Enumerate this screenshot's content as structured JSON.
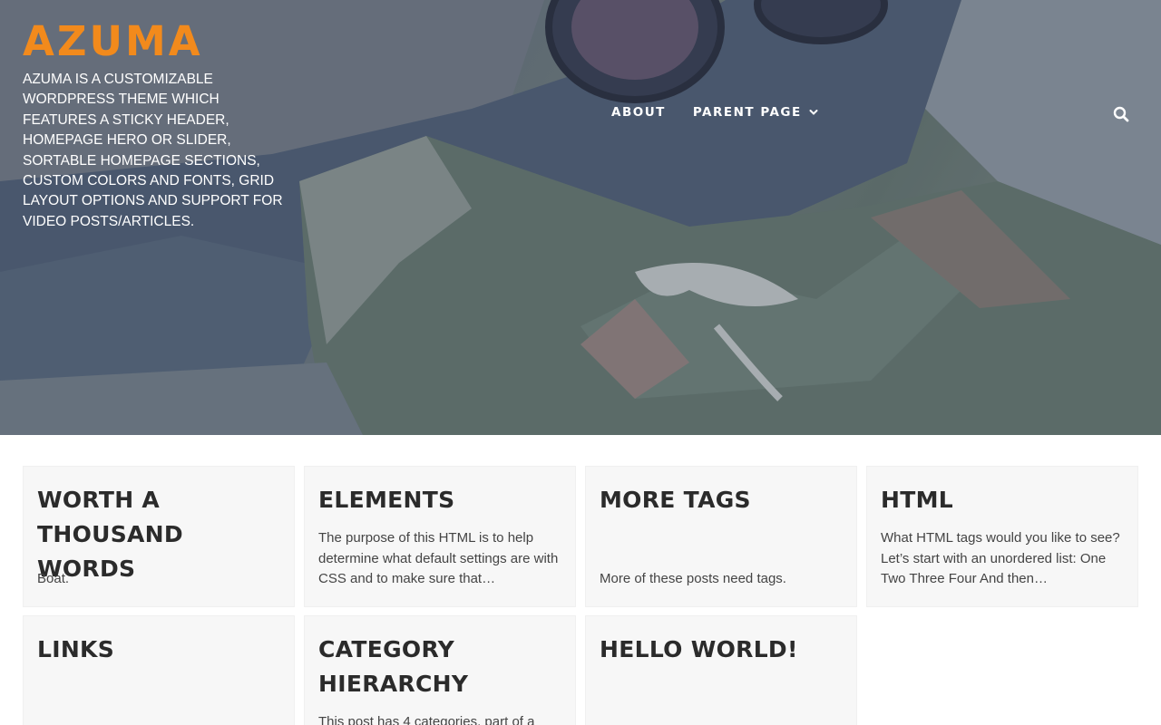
{
  "site": {
    "title": "AZUMA",
    "description": "AZUMA IS A CUSTOMIZABLE WORDPRESS THEME WHICH FEATURES A STICKY HEADER, HOMEPAGE HERO OR SLIDER, SORTABLE HOMEPAGE SECTIONS, CUSTOM COLORS AND FONTS, GRID LAYOUT OPTIONS AND SUPPORT FOR VIDEO POSTS/ARTICLES."
  },
  "nav": {
    "items": [
      {
        "label": "ABOUT"
      },
      {
        "label": "PARENT PAGE",
        "has_dropdown": true
      }
    ],
    "search_icon": "search-icon"
  },
  "colors": {
    "accent": "#f28a1c",
    "card_bg": "#f7f7f7",
    "title_text": "#2b2b2b"
  },
  "posts": [
    {
      "title": "WORTH A THOUSAND WORDS",
      "excerpt": "Boat."
    },
    {
      "title": "ELEMENTS",
      "excerpt": "The purpose of this HTML is to help determine what default settings are with CSS and to make sure that…"
    },
    {
      "title": "MORE TAGS",
      "excerpt": "More of these posts need tags."
    },
    {
      "title": "HTML",
      "excerpt": "What HTML tags would you like to see? Let’s start with an unordered list: One Two Three Four And then…"
    },
    {
      "title": "LINKS",
      "excerpt": ""
    },
    {
      "title": "CATEGORY HIERARCHY",
      "excerpt": "This post has 4 categories, part of a"
    },
    {
      "title": "HELLO WORLD!",
      "excerpt": ""
    }
  ]
}
